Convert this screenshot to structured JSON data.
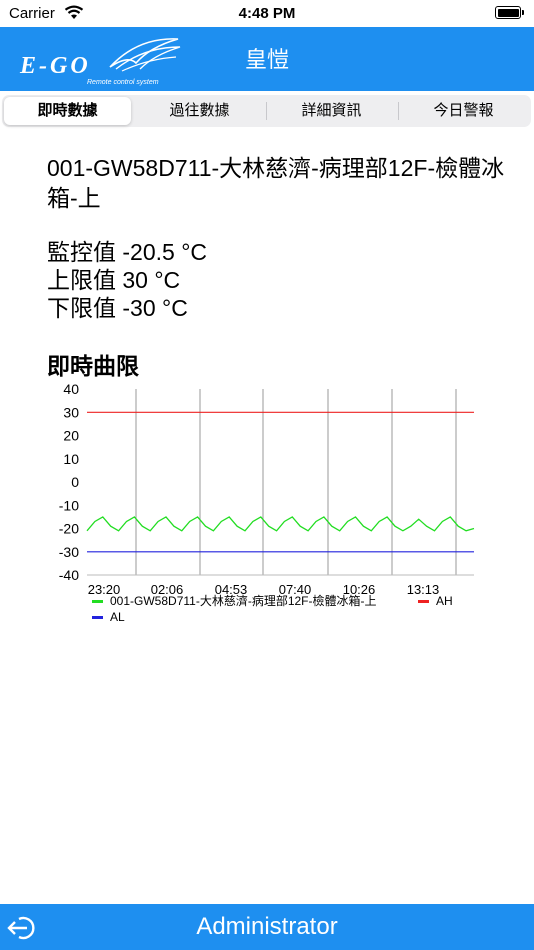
{
  "status": {
    "carrier": "Carrier",
    "time": "4:48 PM"
  },
  "header": {
    "title": "皇愷",
    "logo_text": "E-GO",
    "logo_subtext": "Remote control system"
  },
  "tabs": [
    {
      "label": "即時數據",
      "active": true
    },
    {
      "label": "過往數據",
      "active": false
    },
    {
      "label": "詳細資訊",
      "active": false
    },
    {
      "label": "今日警報",
      "active": false
    }
  ],
  "device": {
    "name": "001-GW58D711-大林慈濟-病理部12F-檢體冰箱-上",
    "monitor": "監控值 -20.5 °C",
    "upper": "上限值 30 °C",
    "lower": "下限值 -30 °C"
  },
  "section_title": "即時曲限",
  "colors": {
    "accent": "#1e8ff0",
    "series": "#22dd22",
    "ah": "#ee2222",
    "al": "#2222dd"
  },
  "chart_data": {
    "type": "line",
    "x_tick_labels": [
      "23:20",
      "02:06",
      "04:53",
      "07:40",
      "10:26",
      "13:13"
    ],
    "y_ticks": [
      40,
      30,
      20,
      10,
      0,
      -10,
      -20,
      -30,
      -40
    ],
    "ylim": [
      -40,
      40
    ],
    "grid_x": true,
    "legend_position": "bottom",
    "series": [
      {
        "name": "001-GW58D711-大林慈濟-病理部12F-檢體冰箱-上",
        "color": "#22dd22",
        "values": [
          -21,
          -17,
          -15,
          -19,
          -21,
          -17,
          -15,
          -19,
          -21,
          -17,
          -15,
          -19,
          -21,
          -17,
          -15,
          -19,
          -21,
          -17,
          -15,
          -19,
          -21,
          -17,
          -15,
          -19,
          -21,
          -17,
          -15,
          -19,
          -21,
          -17,
          -15,
          -19,
          -21,
          -17,
          -15,
          -19,
          -21,
          -17,
          -15,
          -19,
          -21,
          -19,
          -16,
          -19,
          -21,
          -17,
          -15,
          -19,
          -21,
          -20
        ]
      },
      {
        "name": "AH",
        "color": "#ee2222",
        "values": [
          30,
          30
        ]
      },
      {
        "name": "AL",
        "color": "#2222dd",
        "values": [
          -30,
          -30
        ]
      }
    ]
  },
  "footer": {
    "user": "Administrator"
  }
}
